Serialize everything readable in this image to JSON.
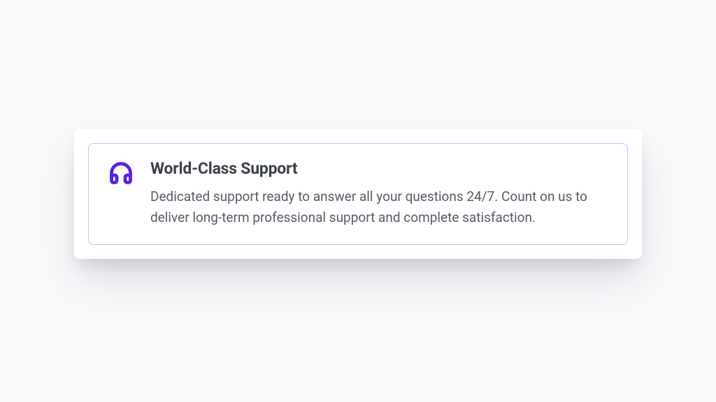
{
  "feature": {
    "icon": "headphones-icon",
    "title": "World-Class Support",
    "description": "Dedicated support ready to answer all your questions 24/7. Count on us to deliver long-term professional support and complete satisfaction."
  },
  "colors": {
    "accent": "#5B21E6",
    "inner_border": "#cabffb",
    "page_bg": "#f7f8fa"
  }
}
